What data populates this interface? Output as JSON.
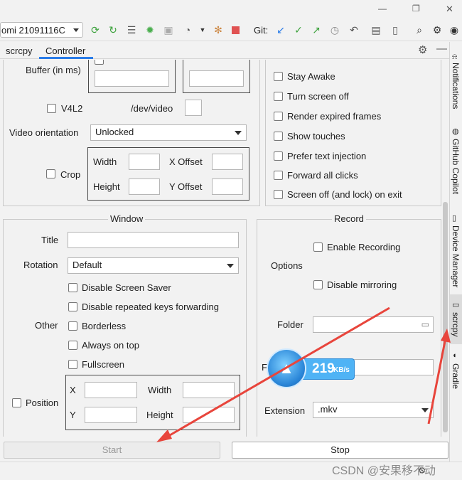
{
  "window": {
    "controls": {
      "minimize": "—",
      "restore": "❐",
      "close": "✕"
    }
  },
  "toolbar": {
    "device": "omi 21091116C",
    "git_label": "Git:"
  },
  "tabs": [
    {
      "label": "scrcpy"
    },
    {
      "label": "Controller"
    }
  ],
  "sidepanel": [
    {
      "label": "Notifications"
    },
    {
      "label": "GitHub Copilot"
    },
    {
      "label": "Device Manager"
    },
    {
      "label": "scrcpy"
    },
    {
      "label": "Gradle"
    }
  ],
  "video": {
    "buffer_label": "Buffer (in ms)",
    "v4l2_label": "V4L2",
    "v4l2_path": "/dev/video",
    "orientation_label": "Video orientation",
    "orientation_value": "Unlocked",
    "crop_label": "Crop",
    "width_label": "Width",
    "x_offset_label": "X Offset",
    "height_label": "Height",
    "y_offset_label": "Y Offset"
  },
  "options": {
    "stay_awake": "Stay Awake",
    "turn_screen_off": "Turn screen off",
    "render_expired": "Render expired frames",
    "show_touches": "Show touches",
    "prefer_text": "Prefer text injection",
    "forward_clicks": "Forward all clicks",
    "screen_off_exit": "Screen off (and lock) on exit"
  },
  "window_group": {
    "title": "Window",
    "title_label": "Title",
    "rotation_label": "Rotation",
    "rotation_value": "Default",
    "other_label": "Other",
    "disable_saver": "Disable Screen Saver",
    "disable_repeat": "Disable repeated keys forwarding",
    "borderless": "Borderless",
    "always_on_top": "Always on top",
    "fullscreen": "Fullscreen",
    "position_label": "Position",
    "x_label": "X",
    "y_label": "Y",
    "width_label": "Width",
    "height_label": "Height"
  },
  "record": {
    "title": "Record",
    "options_label": "Options",
    "enable_recording": "Enable Recording",
    "disable_mirroring": "Disable mirroring",
    "folder_label": "Folder",
    "file_label_partial": "F",
    "extension_label": "Extension",
    "extension_value": ".mkv"
  },
  "speed_widget": {
    "value": "219",
    "unit": "KB/s"
  },
  "actions": {
    "start": "Start",
    "stop": "Stop"
  },
  "watermark": "CSDN @安果移不动",
  "colors": {
    "accent_blue": "#2b7de9",
    "arrow_red": "#e8453c",
    "speed_bg": "#4fb3f5"
  }
}
